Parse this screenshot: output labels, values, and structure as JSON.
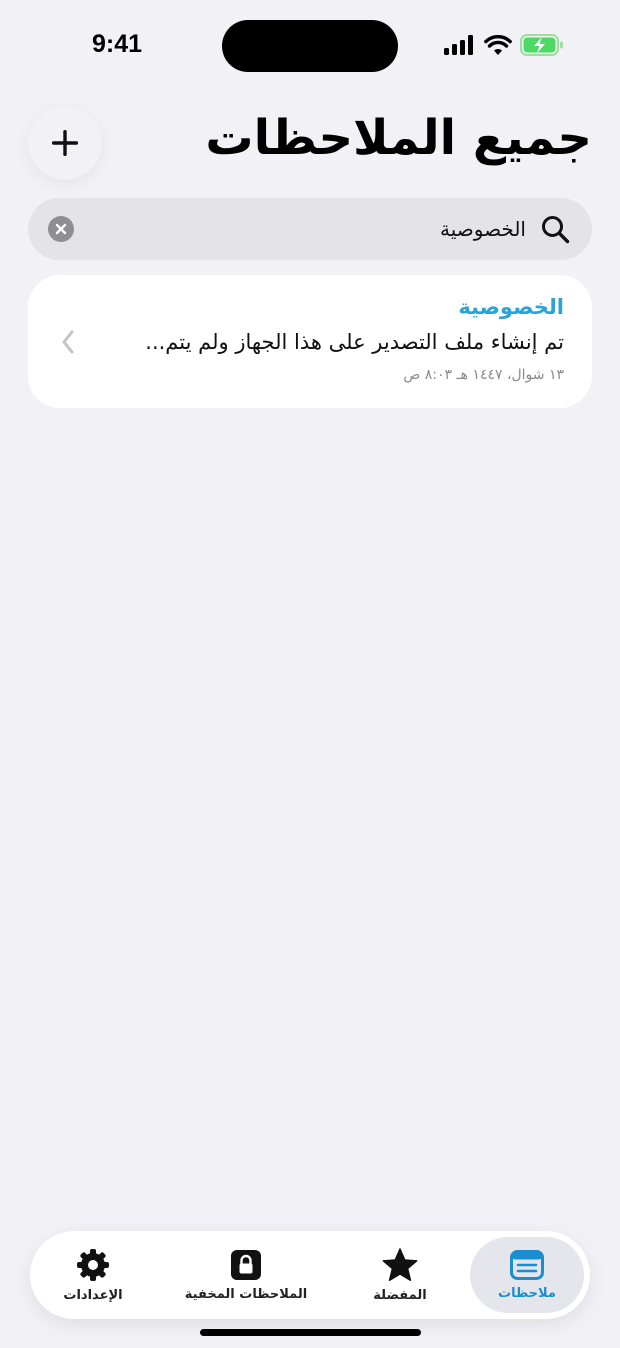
{
  "status_bar": {
    "time": "9:41"
  },
  "header": {
    "title": "جميع الملاحظات",
    "add_button_label": "+"
  },
  "search": {
    "value": "الخصوصية"
  },
  "notes": [
    {
      "title": "الخصوصية",
      "preview": "تم إنشاء ملف التصدير على هذا الجهاز ولم يتم...",
      "date": "١٣ شوال، ١٤٤٧ هـ ٨:٠٣ ص"
    }
  ],
  "tab_bar": {
    "tabs": [
      {
        "label": "ملاحظات",
        "icon": "notes-icon",
        "active": true
      },
      {
        "label": "المفضلة",
        "icon": "star-icon",
        "active": false
      },
      {
        "label": "الملاحظات المخفية",
        "icon": "lock-icon",
        "active": false
      },
      {
        "label": "الإعدادات",
        "icon": "gear-icon",
        "active": false
      }
    ]
  },
  "colors": {
    "background": "#f1f1f6",
    "accent": "#2aa4d8",
    "tab_active": "#1a8fd0"
  }
}
